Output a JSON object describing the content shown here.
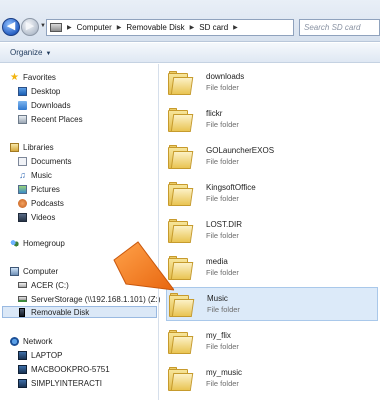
{
  "address_bar": {
    "breadcrumbs": [
      "Computer",
      "Removable Disk",
      "SD card"
    ],
    "search_placeholder": "Search SD card"
  },
  "toolbar": {
    "organize_label": "Organize"
  },
  "nav_pane": {
    "favorites": {
      "label": "Favorites",
      "items": [
        {
          "label": "Desktop",
          "icon": "desktop-icon"
        },
        {
          "label": "Downloads",
          "icon": "downloads-folder-icon"
        },
        {
          "label": "Recent Places",
          "icon": "recent-places-icon"
        }
      ]
    },
    "libraries": {
      "label": "Libraries",
      "items": [
        {
          "label": "Documents",
          "icon": "documents-icon"
        },
        {
          "label": "Music",
          "icon": "music-icon"
        },
        {
          "label": "Pictures",
          "icon": "pictures-icon"
        },
        {
          "label": "Podcasts",
          "icon": "podcasts-icon"
        },
        {
          "label": "Videos",
          "icon": "videos-icon"
        }
      ]
    },
    "homegroup": {
      "label": "Homegroup"
    },
    "computer": {
      "label": "Computer",
      "items": [
        {
          "label": "ACER (C:)",
          "icon": "drive-icon"
        },
        {
          "label": "ServerStorage (\\\\192.168.1.101) (Z:)",
          "icon": "network-drive-icon"
        },
        {
          "label": "Removable Disk",
          "icon": "removable-disk-icon",
          "selected": true
        }
      ]
    },
    "network": {
      "label": "Network",
      "items": [
        {
          "label": "LAPTOP",
          "icon": "computer-icon"
        },
        {
          "label": "MACBOOKPRO-5751",
          "icon": "computer-icon"
        },
        {
          "label": "SIMPLYINTERACTI",
          "icon": "computer-icon"
        }
      ]
    }
  },
  "content": {
    "folders": [
      {
        "name": "downloads",
        "type": "File folder"
      },
      {
        "name": "flickr",
        "type": "File folder"
      },
      {
        "name": "GOLauncherEXOS",
        "type": "File folder"
      },
      {
        "name": "KingsoftOffice",
        "type": "File folder"
      },
      {
        "name": "LOST.DIR",
        "type": "File folder"
      },
      {
        "name": "media",
        "type": "File folder"
      },
      {
        "name": "Music",
        "type": "File folder",
        "selected": true
      },
      {
        "name": "my_flix",
        "type": "File folder"
      },
      {
        "name": "my_music",
        "type": "File folder"
      }
    ]
  },
  "colors": {
    "pointer_orange": "#f47b20",
    "selection_bg": "#dceaf9"
  }
}
